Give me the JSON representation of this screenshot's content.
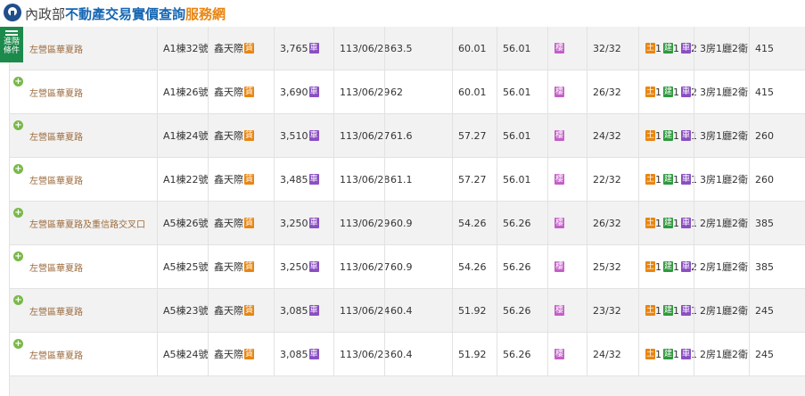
{
  "header": {
    "org": "內政部",
    "title": "不動產交易實價查詢",
    "service": "服務網"
  },
  "advanced": {
    "line1": "進階",
    "line2": "條件"
  },
  "badges": {
    "build": "建",
    "lease": "賃",
    "floor": "樓",
    "land": "土",
    "building": "建",
    "car": "車"
  },
  "rows": [
    {
      "addr": "左營區華夏路",
      "unit": "A1棟32號",
      "community": "鑫天際",
      "price": "3,765",
      "date": "113/06/28",
      "area": "63.5",
      "c1": "60.01",
      "c2": "56.01",
      "floor": "32/32",
      "land": "1",
      "bld": "1",
      "car": "2",
      "layout": "3房1廳2衛",
      "unitPrice": "415"
    },
    {
      "addr": "左營區華夏路",
      "unit": "A1棟26號",
      "community": "鑫天際",
      "price": "3,690",
      "date": "113/06/29",
      "area": "62",
      "c1": "60.01",
      "c2": "56.01",
      "floor": "26/32",
      "land": "1",
      "bld": "1",
      "car": "2",
      "layout": "3房1廳2衛",
      "unitPrice": "415"
    },
    {
      "addr": "左營區華夏路",
      "unit": "A1棟24號",
      "community": "鑫天際",
      "price": "3,510",
      "date": "113/06/27",
      "area": "61.6",
      "c1": "57.27",
      "c2": "56.01",
      "floor": "24/32",
      "land": "1",
      "bld": "1",
      "car": "1",
      "layout": "3房1廳2衛",
      "unitPrice": "260"
    },
    {
      "addr": "左營區華夏路",
      "unit": "A1棟22號",
      "community": "鑫天際",
      "price": "3,485",
      "date": "113/06/28",
      "area": "61.1",
      "c1": "57.27",
      "c2": "56.01",
      "floor": "22/32",
      "land": "1",
      "bld": "1",
      "car": "1",
      "layout": "3房1廳2衛",
      "unitPrice": "260"
    },
    {
      "addr": "左營區華夏路及重信路交叉口",
      "unit": "A5棟26號",
      "community": "鑫天際",
      "price": "3,250",
      "date": "113/06/29",
      "area": "60.9",
      "c1": "54.26",
      "c2": "56.26",
      "floor": "26/32",
      "land": "1",
      "bld": "1",
      "car": "1",
      "layout": "2房1廳2衛",
      "unitPrice": "385"
    },
    {
      "addr": "左營區華夏路",
      "unit": "A5棟25號",
      "community": "鑫天際",
      "price": "3,250",
      "date": "113/06/27",
      "area": "60.9",
      "c1": "54.26",
      "c2": "56.26",
      "floor": "25/32",
      "land": "1",
      "bld": "1",
      "car": "2",
      "layout": "2房1廳2衛",
      "unitPrice": "385"
    },
    {
      "addr": "左營區華夏路",
      "unit": "A5棟23號",
      "community": "鑫天際",
      "price": "3,085",
      "date": "113/06/24",
      "area": "60.4",
      "c1": "51.92",
      "c2": "56.26",
      "floor": "23/32",
      "land": "1",
      "bld": "1",
      "car": "1",
      "layout": "2房1廳2衛",
      "unitPrice": "245"
    },
    {
      "addr": "左營區華夏路",
      "unit": "A5棟24號",
      "community": "鑫天際",
      "price": "3,085",
      "date": "113/06/23",
      "area": "60.4",
      "c1": "51.92",
      "c2": "56.26",
      "floor": "24/32",
      "land": "1",
      "bld": "1",
      "car": "1",
      "layout": "2房1廳2衛",
      "unitPrice": "245"
    }
  ]
}
